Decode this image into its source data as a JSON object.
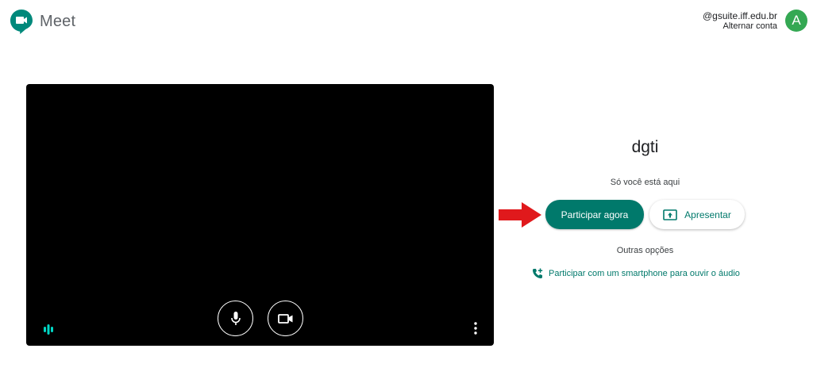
{
  "header": {
    "app_name": "Meet",
    "account_email": "@gsuite.iff.edu.br",
    "switch_account": "Alternar conta",
    "avatar_letter": "A"
  },
  "preview": {
    "icons": {
      "mic": "microphone-icon",
      "camera": "video-camera-icon",
      "audio_level": "audio-level-icon",
      "more": "more-vert-icon"
    }
  },
  "panel": {
    "meeting_name": "dgti",
    "status": "Só você está aqui",
    "join_label": "Participar agora",
    "present_label": "Apresentar",
    "other_options": "Outras opções",
    "phone_audio_label": "Participar com um smartphone para ouvir o áudio"
  },
  "colors": {
    "accent": "#00796b",
    "avatar": "#34a853",
    "arrow": "#e0191c",
    "audio_level": "#00d7c5"
  }
}
